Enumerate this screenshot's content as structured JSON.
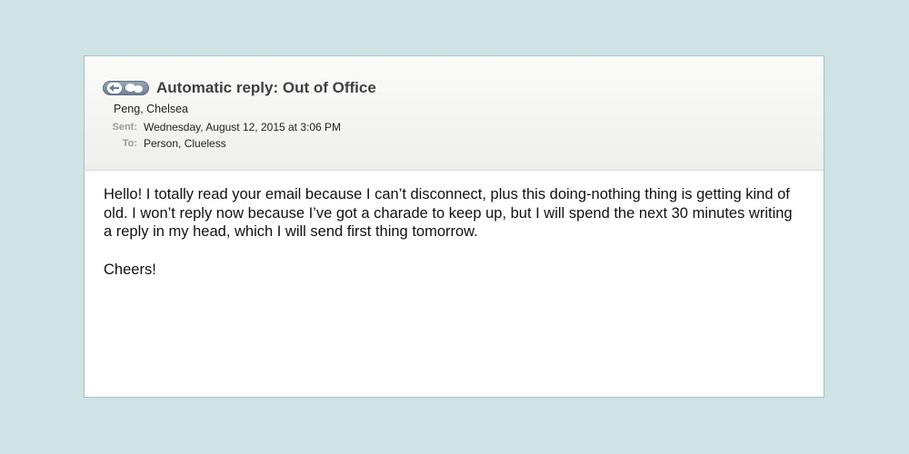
{
  "email": {
    "subject": "Automatic reply: Out of Office",
    "from": "Peng, Chelsea",
    "sent_label": "Sent:",
    "sent_value": "Wednesday, August 12, 2015 at 3:06 PM",
    "to_label": "To:",
    "to_value": "Person, Clueless",
    "body_paragraph": "Hello! I totally read your email because I can’t disconnect, plus this doing-nothing thing is getting kind of old. I won’t reply now because I’ve got a charade to keep up, but I will spend the next 30 minutes writing a reply in my head, which I will send first thing tomorrow.",
    "signoff": "Cheers!"
  },
  "icons": {
    "conversation": "conversation-icon"
  }
}
